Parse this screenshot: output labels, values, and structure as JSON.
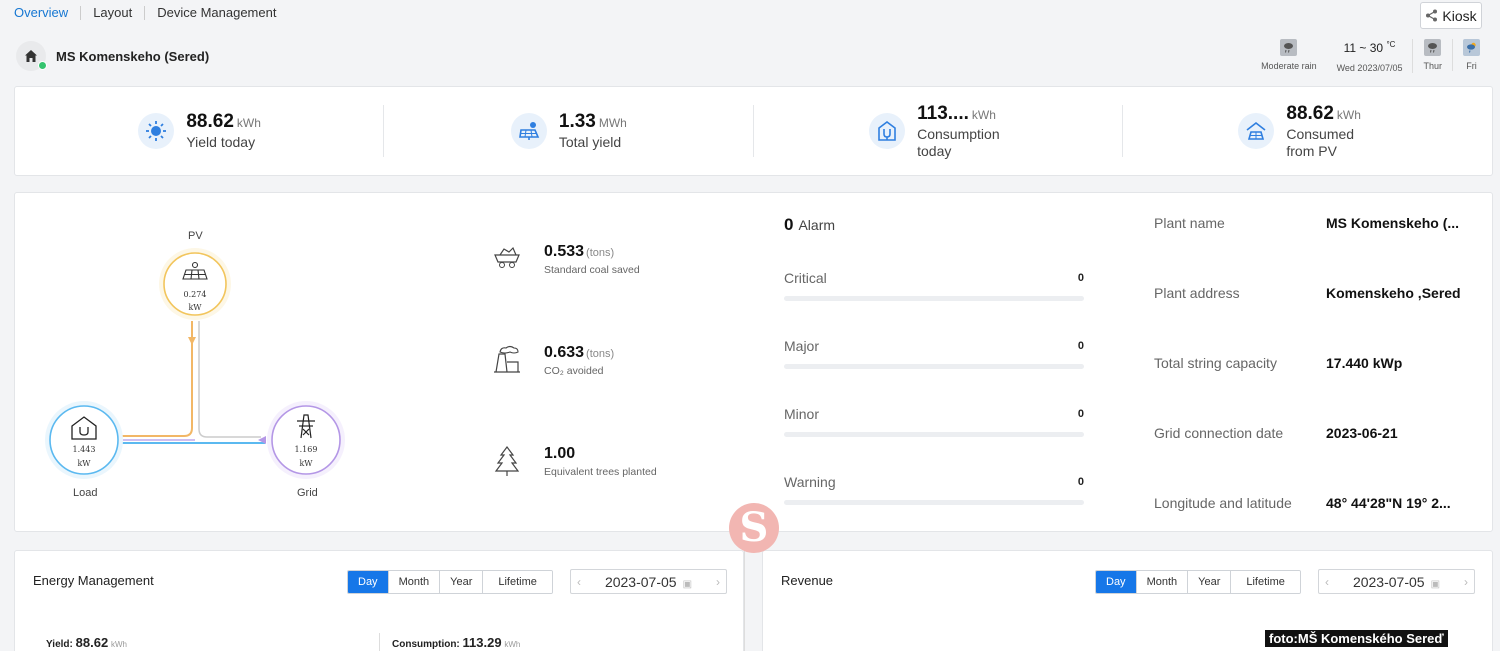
{
  "nav": {
    "tabs": [
      "Overview",
      "Layout",
      "Device Management"
    ],
    "kiosk_label": "Kiosk"
  },
  "plant": {
    "title": "MS Komenskeho (Sered)"
  },
  "weather": {
    "today_desc": "Moderate rain",
    "temp": "11 ~ 30",
    "temp_unit": "°C",
    "date": "Wed  2023/07/05",
    "day2": "Thur",
    "day3": "Fri"
  },
  "kpis": [
    {
      "value": "88.62",
      "unit": "kWh",
      "label": "Yield today",
      "icon": "sun-icon"
    },
    {
      "value": "1.33",
      "unit": "MWh",
      "label": "Total yield",
      "icon": "solar-panel-icon"
    },
    {
      "value": "113....",
      "unit": "kWh",
      "label": "Consumption today",
      "icon": "plug-icon"
    },
    {
      "value": "88.62",
      "unit": "kWh",
      "label": "Consumed from PV",
      "icon": "pv-house-icon"
    }
  ],
  "flow": {
    "pv": {
      "label": "PV",
      "value": "0.274",
      "unit": "kW"
    },
    "load": {
      "label": "Load",
      "value": "1.443",
      "unit": "kW"
    },
    "grid": {
      "label": "Grid",
      "value": "1.169",
      "unit": "kW"
    },
    "colors": {
      "pv": "#f2c55c",
      "load": "#5bb9f0",
      "grid": "#b497e6"
    }
  },
  "env": [
    {
      "value": "0.533",
      "unit": "(tons)",
      "label": "Standard coal saved",
      "icon": "coal-cart-icon"
    },
    {
      "value": "0.633",
      "unit": "(tons)",
      "label": "CO₂ avoided",
      "icon": "factory-icon"
    },
    {
      "value": "1.00",
      "unit": "",
      "label": "Equivalent trees planted",
      "icon": "tree-icon"
    }
  ],
  "alarms": {
    "count": "0",
    "label": "Alarm",
    "rows": [
      {
        "name": "Critical",
        "count": "0"
      },
      {
        "name": "Major",
        "count": "0"
      },
      {
        "name": "Minor",
        "count": "0"
      },
      {
        "name": "Warning",
        "count": "0"
      }
    ]
  },
  "info": [
    {
      "key": "Plant name",
      "value": "MS Komenskeho (..."
    },
    {
      "key": "Plant address",
      "value": "Komenskeho  ,Sered"
    },
    {
      "key": "Total string capacity",
      "value": "17.440 kWp"
    },
    {
      "key": "Grid connection date",
      "value": "2023-06-21"
    },
    {
      "key": "Longitude and latitude",
      "value": "48° 44'28\"N   19° 2..."
    }
  ],
  "energy": {
    "title": "Energy Management",
    "periods": [
      "Day",
      "Month",
      "Year",
      "Lifetime"
    ],
    "date": "2023-07-05",
    "yield_label": "Yield:",
    "yield_value": "88.62",
    "yield_unit": "kWh",
    "cons_label": "Consumption:",
    "cons_value": "113.29",
    "cons_unit": "kWh"
  },
  "revenue": {
    "title": "Revenue",
    "periods": [
      "Day",
      "Month",
      "Year",
      "Lifetime"
    ],
    "date": "2023-07-05"
  },
  "watermark": "foto:MŠ Komenského Sereď",
  "logo_letter": "S"
}
